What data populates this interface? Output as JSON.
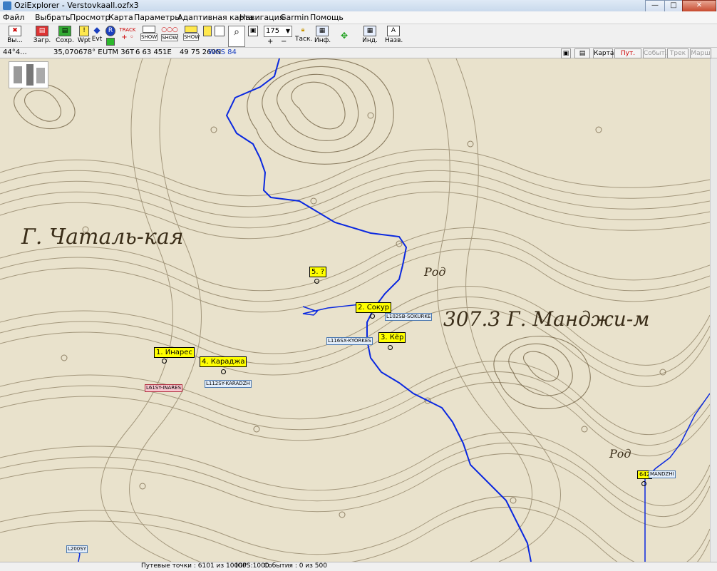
{
  "window": {
    "title": "OziExplorer - Verstovkaall.ozfx3",
    "buttons": [
      "—",
      "□",
      "✕"
    ]
  },
  "menu": [
    "Файл",
    "Выбрать",
    "Просмотр",
    "Карта",
    "Параметры",
    "Адаптивная карта",
    "Навигация",
    "Garmin",
    "Помощь"
  ],
  "toolbar": {
    "exit": "Вы...",
    "load": "Загр.",
    "save": "Сохр.",
    "wpt": "Wpt",
    "evt": "Evt",
    "track": "TRACK",
    "show1": "SHOW",
    "show2": "SHOW",
    "show3": "SHOW",
    "zoom": "175",
    "tasks": "Таск.",
    "info": "Инф.",
    "ind": "Инд.",
    "names": "Назв."
  },
  "coords": {
    "lat": "44°4...",
    "lon": "35,070678° E",
    "utm": "UTM  36T",
    "easting": "6 63 451E",
    "northing": "49 75 260N",
    "datum": "WGS 84"
  },
  "right_buttons": [
    "Карта",
    "Пут. точ.",
    "Событ.",
    "Трек",
    "Марш"
  ],
  "map": {
    "labels": {
      "mountain1": "Г. Чаталь-кая",
      "mountain2": "307.3 Г. Манджи-м",
      "rod1": "Род",
      "rod2": "Род"
    },
    "waypoints": [
      {
        "name": "1. Инарес"
      },
      {
        "name": "2. Сокур"
      },
      {
        "name": "3. Кёр"
      },
      {
        "name": "4. Караджа"
      },
      {
        "name": "5. ?"
      },
      {
        "name": "642"
      }
    ],
    "track_points": [
      {
        "name": "L61SY-INARES",
        "style": "red"
      },
      {
        "name": "L112SY-KARADZH"
      },
      {
        "name": "L116SX-KYORKES"
      },
      {
        "name": "L102SB-SOKURKE"
      },
      {
        "name": "L200SY"
      },
      {
        "name": "MANDZHI"
      }
    ]
  },
  "status": {
    "waypoints": "Путевые точки : 6101 из 10000",
    "gps": "(GPS:1000",
    "events": "События : 0 из 500"
  }
}
